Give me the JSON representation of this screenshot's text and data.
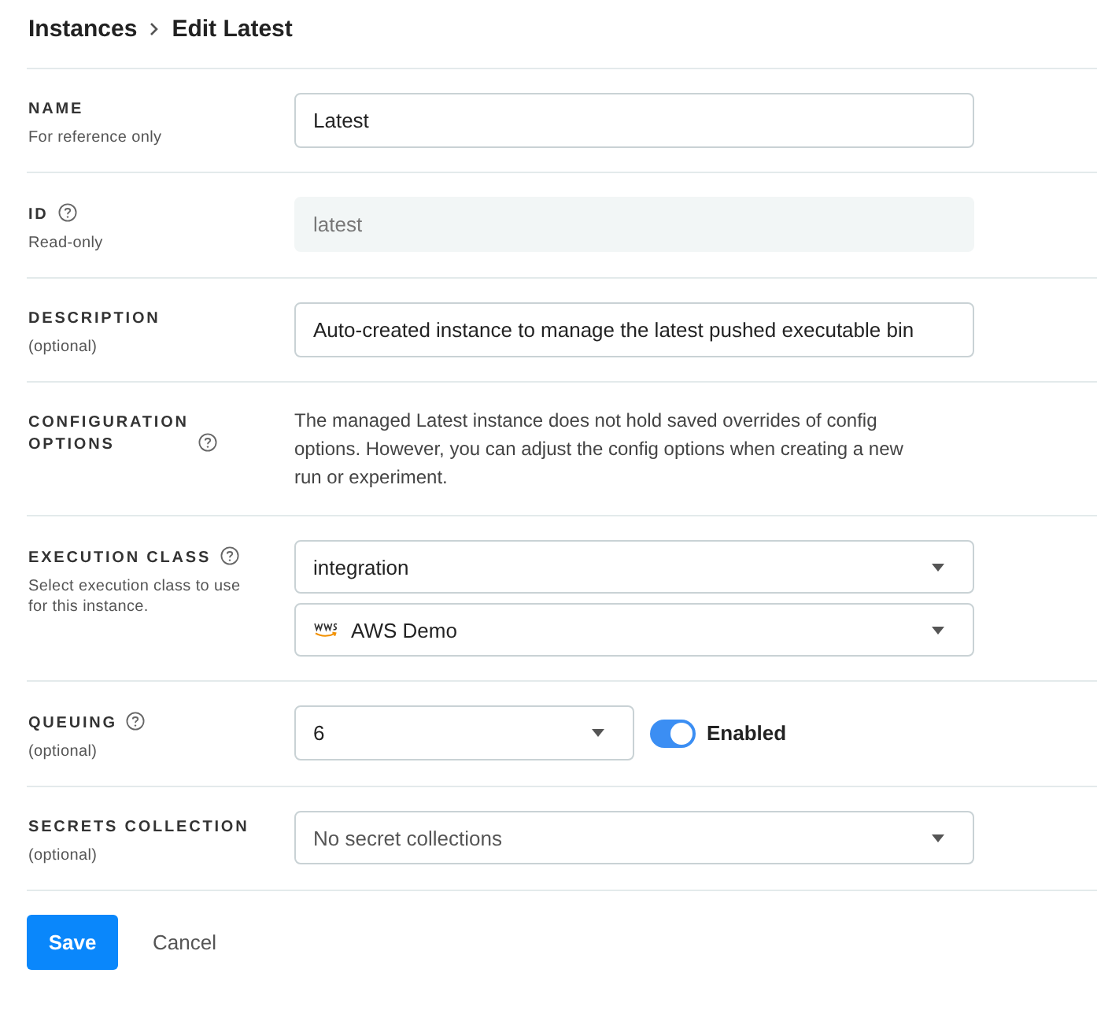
{
  "breadcrumb": {
    "parent": "Instances",
    "current": "Edit Latest"
  },
  "fields": [
    {
      "kind": "controls",
      "label": "NAME",
      "help": false,
      "hint": "For reference only",
      "controls": [
        {
          "kind": "input",
          "value": "Latest",
          "disabled": false
        }
      ]
    },
    {
      "kind": "controls",
      "label": "ID",
      "help": true,
      "hint": "Read-only",
      "controls": [
        {
          "kind": "input",
          "value": "latest",
          "disabled": true
        }
      ]
    },
    {
      "kind": "controls",
      "label": "DESCRIPTION",
      "help": false,
      "hint": "(optional)",
      "controls": [
        {
          "kind": "input",
          "value": "Auto-created instance to manage the latest pushed executable bin",
          "disabled": false
        }
      ]
    },
    {
      "kind": "note",
      "label": "CONFIGURATION OPTIONS",
      "help": true,
      "text": "The managed Latest instance does not hold saved overrides of config options. However, you can adjust the config options when creating a new run or experiment."
    },
    {
      "kind": "controls",
      "label": "EXECUTION CLASS",
      "help": true,
      "hint": "Select execution class to use for this instance.",
      "controls": [
        {
          "kind": "select",
          "value": "integration",
          "logo": false
        },
        {
          "kind": "select",
          "value": "AWS Demo",
          "logo": true
        }
      ]
    },
    {
      "kind": "inline",
      "label": "QUEUING",
      "help": true,
      "hint": "(optional)",
      "controls": [
        {
          "kind": "select",
          "value": "6",
          "logo": false
        },
        {
          "kind": "toggle",
          "on": true,
          "label": "Enabled"
        }
      ]
    },
    {
      "kind": "controls",
      "label": "SECRETS COLLECTION",
      "help": false,
      "hint": "(optional)",
      "controls": [
        {
          "kind": "select",
          "placeholder": "No secret collections",
          "logo": false
        }
      ]
    }
  ],
  "actions": {
    "primary": "Save",
    "secondary": "Cancel"
  }
}
